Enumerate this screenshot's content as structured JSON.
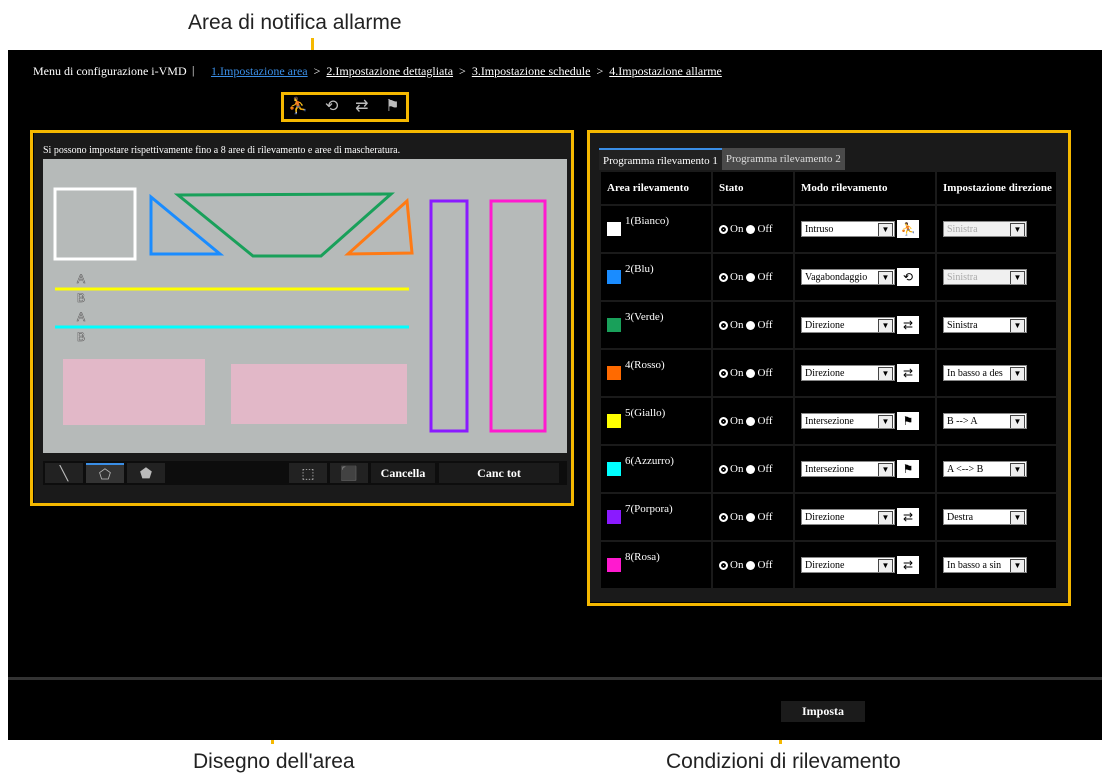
{
  "annotations": {
    "alarm_area": "Area di notifica allarme",
    "area_drawing": "Disegno dell'area",
    "detection_conditions": "Condizioni di rilevamento"
  },
  "header": {
    "menu_title": "Menu di configurazione i-VMD",
    "separator": "|",
    "steps": [
      "1.Impostazione area",
      "2.Impostazione dettagliata",
      "3.Impostazione schedule",
      "4.Impostazione allarme"
    ],
    "arrow": ">"
  },
  "alarm_icons": [
    "intruder-icon",
    "loitering-icon",
    "direction-icon",
    "crossing-icon"
  ],
  "drawing": {
    "hint": "Si possono impostare rispettivamente fino a 8 aree di rilevamento e aree di mascheratura.",
    "cancel_label": "Cancella",
    "cancel_all_label": "Canc tot",
    "line_labels": [
      "A",
      "B",
      "A",
      "B"
    ],
    "colors": {
      "white": "#ffffff",
      "blue": "#1a8cff",
      "green": "#19a05a",
      "orange": "#ff7a14",
      "yellow": "#ffff00",
      "cyan": "#00ffff",
      "purple": "#8a1aff",
      "pink": "#ff1acf",
      "mask": "#e8b8cc"
    }
  },
  "conditions": {
    "tabs": [
      "Programma rilevamento 1",
      "Programma rilevamento 2"
    ],
    "headers": [
      "Area rilevamento",
      "Stato",
      "Modo rilevamento",
      "Impostazione direzione"
    ],
    "on_label": "On",
    "off_label": "Off",
    "rows": [
      {
        "area": "1(Bianco)",
        "color": "#ffffff",
        "mode": "Intruso",
        "icon": "intruder-icon",
        "direction": "Sinistra",
        "dir_disabled": true
      },
      {
        "area": "2(Blu)",
        "color": "#1a8cff",
        "mode": "Vagabondaggio",
        "icon": "loitering-icon",
        "direction": "Sinistra",
        "dir_disabled": true
      },
      {
        "area": "3(Verde)",
        "color": "#19a05a",
        "mode": "Direzione",
        "icon": "direction-icon",
        "direction": "Sinistra",
        "dir_disabled": false
      },
      {
        "area": "4(Rosso)",
        "color": "#ff6a00",
        "mode": "Direzione",
        "icon": "direction-icon",
        "direction": "In basso a des",
        "dir_disabled": false
      },
      {
        "area": "5(Giallo)",
        "color": "#ffff00",
        "mode": "Intersezione",
        "icon": "crossing-icon",
        "direction": "B --> A",
        "dir_disabled": false
      },
      {
        "area": "6(Azzurro)",
        "color": "#00ffff",
        "mode": "Intersezione",
        "icon": "crossing-icon",
        "direction": "A <--> B",
        "dir_disabled": false
      },
      {
        "area": "7(Porpora)",
        "color": "#8a1aff",
        "mode": "Direzione",
        "icon": "direction-icon",
        "direction": "Destra",
        "dir_disabled": false
      },
      {
        "area": "8(Rosa)",
        "color": "#ff1acf",
        "mode": "Direzione",
        "icon": "direction-icon",
        "direction": "In basso a sin",
        "dir_disabled": false
      }
    ]
  },
  "footer": {
    "set_label": "Imposta"
  }
}
